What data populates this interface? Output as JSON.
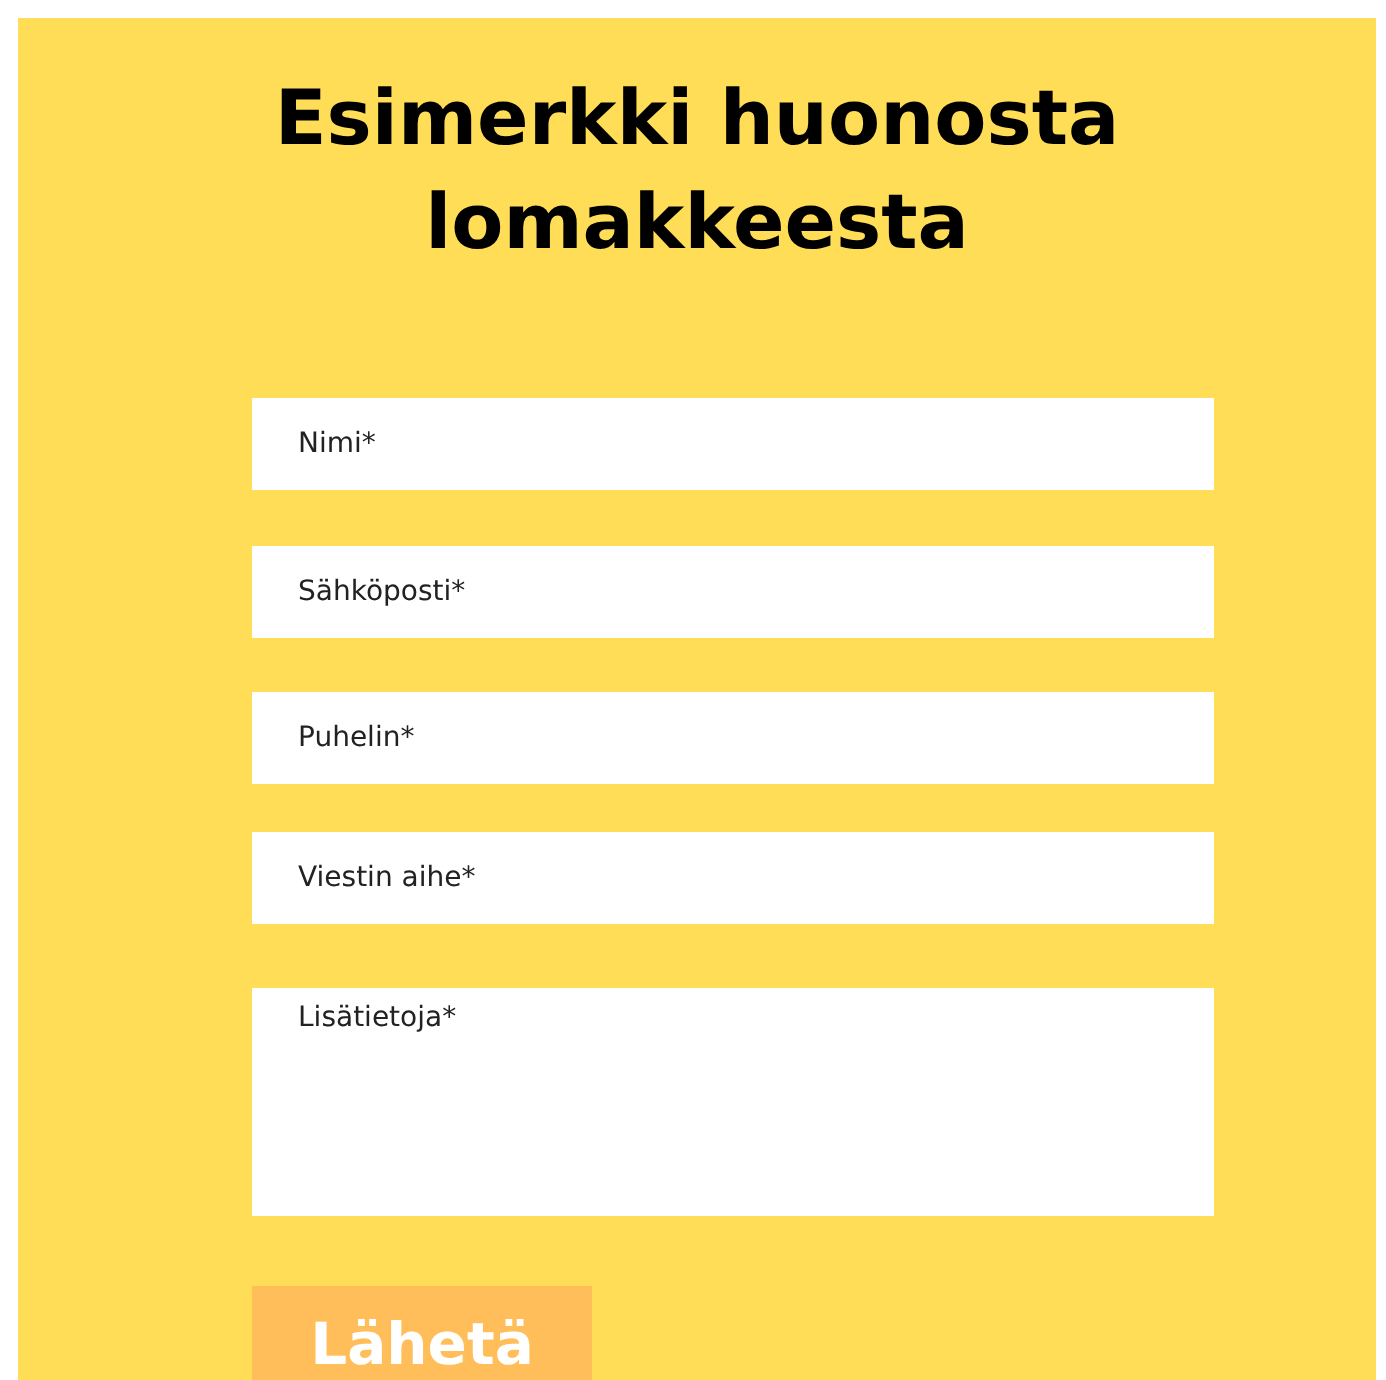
{
  "title": "Esimerkki huonosta lomakkeesta",
  "fields": [
    {
      "kind": "input",
      "placeholder": "Nimi*"
    },
    {
      "kind": "input",
      "placeholder": "Sähköposti*"
    },
    {
      "kind": "input",
      "placeholder": "Puhelin*"
    },
    {
      "kind": "input",
      "placeholder": "Viestin aihe*"
    },
    {
      "kind": "textarea",
      "placeholder": "Lisätietoja*"
    }
  ],
  "button": "Lähetä"
}
